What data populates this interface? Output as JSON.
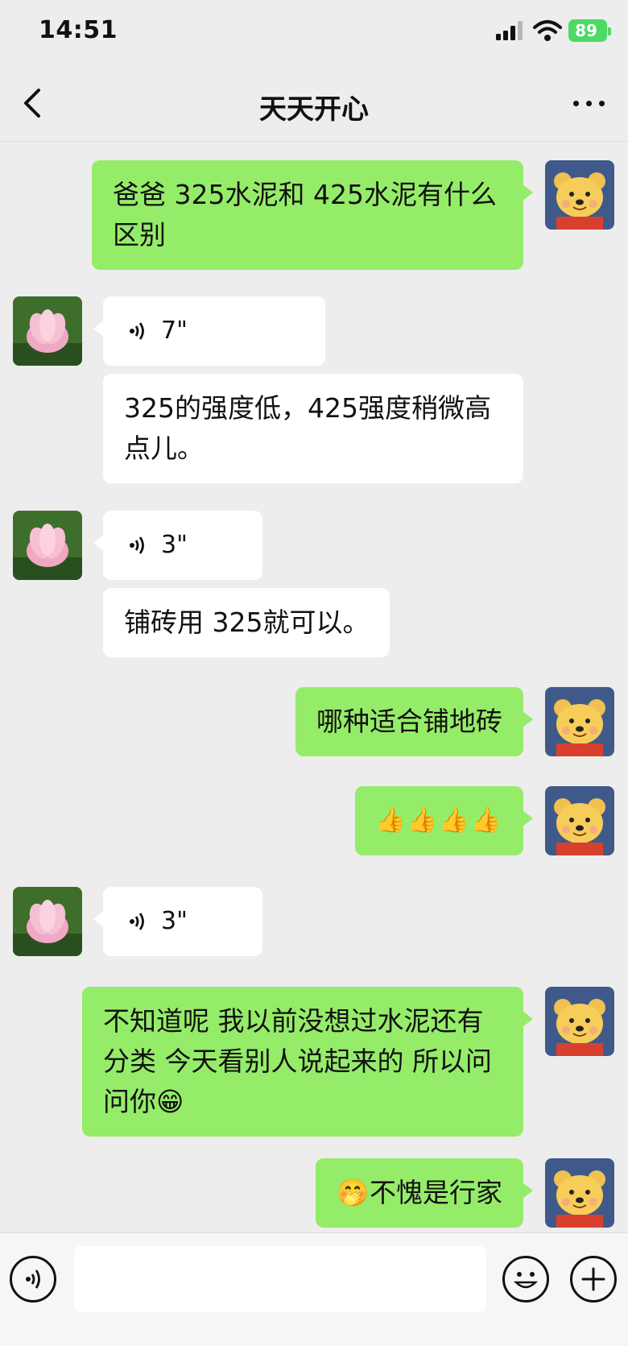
{
  "status": {
    "time": "14:51",
    "battery": "89"
  },
  "header": {
    "title": "天天开心"
  },
  "messages": [
    {
      "from": "me",
      "text": "爸爸 325水泥和 425水泥有什么区别"
    },
    {
      "from": "other",
      "type": "voice",
      "duration": "7\""
    },
    {
      "from": "other",
      "text": "325的强度低，425强度稍微高点儿。"
    },
    {
      "from": "other",
      "type": "voice",
      "duration": "3\""
    },
    {
      "from": "other",
      "text": "铺砖用 325就可以。"
    },
    {
      "from": "me",
      "text": "哪种适合铺地砖"
    },
    {
      "from": "me",
      "text": "👍👍👍👍"
    },
    {
      "from": "other",
      "type": "voice",
      "duration": "3\""
    },
    {
      "from": "me",
      "text": "不知道呢 我以前没想过水泥还有分类 今天看别人说起来的 所以问问你😁"
    },
    {
      "from": "me",
      "text": "🤭不愧是行家"
    }
  ],
  "icons": {
    "back": "chevron-left-icon",
    "more": "more-dots-icon",
    "voice_toggle": "voice-icon",
    "emoji": "emoji-icon",
    "plus": "plus-icon"
  },
  "colors": {
    "my_bubble": "#95ec69",
    "other_bubble": "#ffffff",
    "background": "#ededed",
    "battery": "#4cd964"
  }
}
